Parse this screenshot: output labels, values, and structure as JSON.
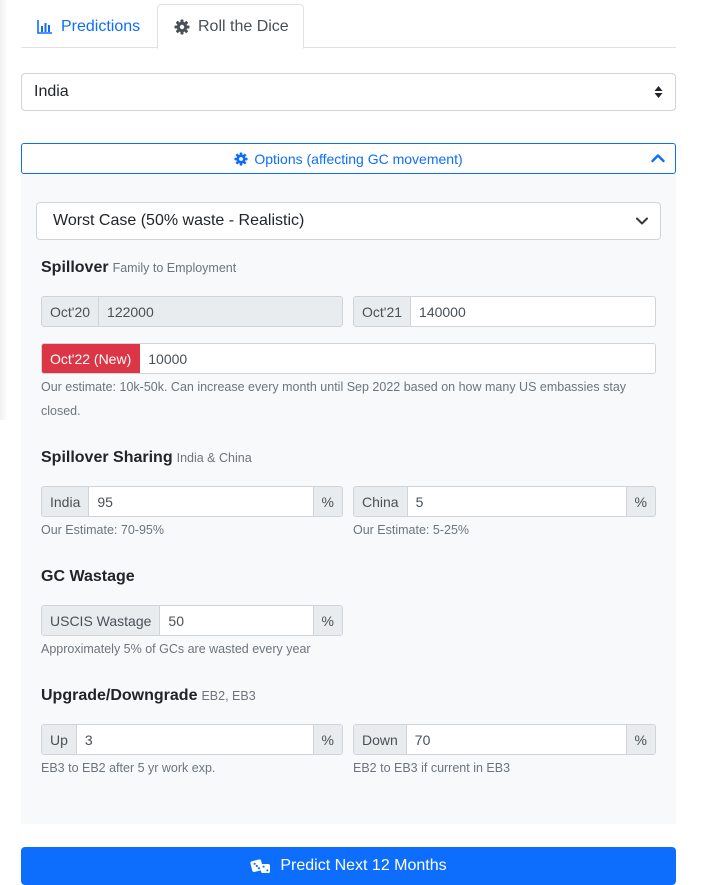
{
  "tabs": {
    "predictions": "Predictions",
    "roll_dice": "Roll the Dice"
  },
  "country_select": {
    "value": "India"
  },
  "options_toggle": {
    "label": "Options (affecting GC movement)"
  },
  "scenario_select": {
    "value": "Worst Case (50% waste - Realistic)"
  },
  "spillover": {
    "title": "Spillover",
    "subtitle": "Family to Employment",
    "oct20": {
      "label": "Oct'20",
      "value": "122000"
    },
    "oct21": {
      "label": "Oct'21",
      "value": "140000"
    },
    "oct22": {
      "label": "Oct'22 (New)",
      "value": "10000"
    },
    "help": "Our estimate: 10k-50k. Can increase every month until Sep 2022 based on how many US embassies stay closed."
  },
  "sharing": {
    "title": "Spillover Sharing",
    "subtitle": "India & China",
    "india": {
      "label": "India",
      "value": "95",
      "unit": "%",
      "help": "Our Estimate: 70-95%"
    },
    "china": {
      "label": "China",
      "value": "5",
      "unit": "%",
      "help": "Our Estimate: 5-25%"
    }
  },
  "wastage": {
    "title": "GC Wastage",
    "uscis": {
      "label": "USCIS Wastage",
      "value": "50",
      "unit": "%"
    },
    "help": "Approximately 5% of GCs are wasted every year"
  },
  "upgrade": {
    "title": "Upgrade/Downgrade",
    "subtitle": "EB2, EB3",
    "up": {
      "label": "Up",
      "value": "3",
      "unit": "%",
      "help": "EB3 to EB2 after 5 yr work exp."
    },
    "down": {
      "label": "Down",
      "value": "70",
      "unit": "%",
      "help": "EB2 to EB3 if current in EB3"
    }
  },
  "predict_button": {
    "label": "Predict Next 12 Months"
  },
  "colors": {
    "primary": "#0d6efd",
    "danger": "#dc3545",
    "panel_bg": "#f8f9fa"
  },
  "icons": {
    "predictions": "bar-chart-icon",
    "roll_dice": "gear-icon",
    "options": "gear-icon",
    "toggle": "chevron-up-icon",
    "predict": "dice-icon"
  }
}
